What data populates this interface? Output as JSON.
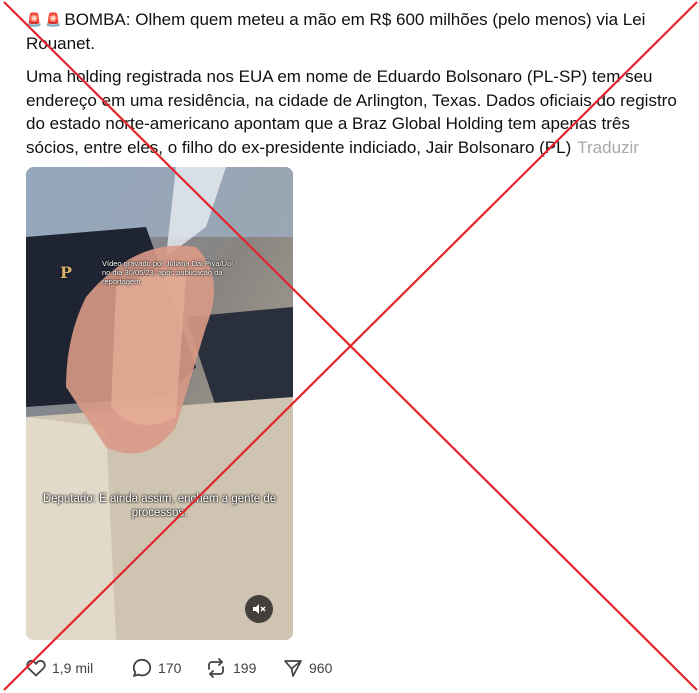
{
  "post": {
    "headline": "BOMBA: Olhem quem meteu a mão em R$ 600 milhões (pelo menos) via Lei Rouanet.",
    "body": "Uma holding registrada nos EUA em nome de Eduardo Bolsonaro (PL-SP) tem seu endereço em uma residência, na cidade de Arlington, Texas. Dados oficiais do registro do estado norte-americano apontam que a Braz Global Holding tem apenas três sócios, entre eles, o filho do ex-presidente indiciado, Jair Bolsonaro (PL)",
    "translate_label": "Traduzir"
  },
  "video": {
    "logo_text": "P",
    "caption_top": "Vídeo gravado por Juliana Dal Piva/Uol no dia 30/05/23, após publicação da reportagem",
    "caption_bottom": "Deputado: E ainda assim, enchem a gente de processos.",
    "muted": true
  },
  "actions": {
    "likes": "1,9 mil",
    "replies": "170",
    "reposts": "199",
    "shares": "960"
  },
  "icons": {
    "emoji": "police-light-icon",
    "like": "heart-icon",
    "reply": "comment-icon",
    "repost": "repost-icon",
    "share": "send-icon",
    "mute": "muted-speaker-icon"
  },
  "overlay": {
    "color": "#e3262b"
  }
}
